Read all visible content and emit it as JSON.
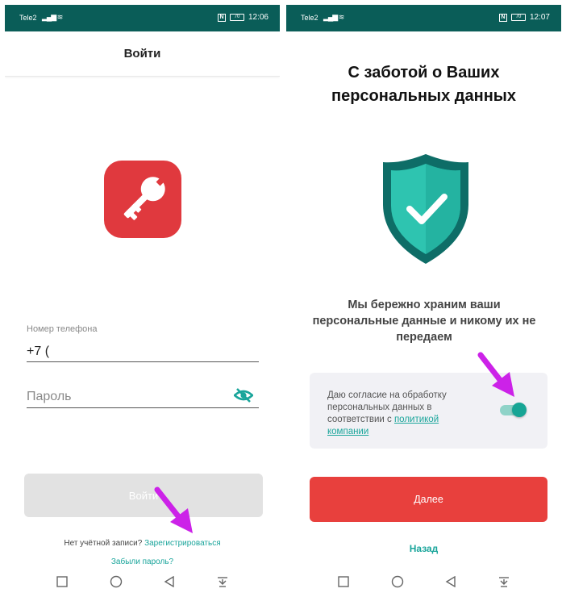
{
  "login": {
    "status": {
      "carrier": "Tele2",
      "time": "12:06",
      "battery": "70"
    },
    "title": "Войти",
    "phone_label": "Номер телефона",
    "phone_value": "+7 (",
    "password_placeholder": "Пароль",
    "login_button": "Войти",
    "no_account_text": "Нет учётной записи?",
    "register_link": "Зарегистрироваться",
    "forgot_link": "Забыли пароль?",
    "logo_icon": "key-icon",
    "eye_icon": "eye-off-icon"
  },
  "consent": {
    "status": {
      "carrier": "Tele2",
      "time": "12:07",
      "battery": "70"
    },
    "title": "С заботой о Ваших персональных данных",
    "subtitle": "Мы бережно храним ваши персональные данные и никому их не передаем",
    "consent_text": "Даю согласие на обработку персональных данных в соответствии с",
    "policy_link": "политикой компании",
    "consent_enabled": true,
    "next_button": "Далее",
    "back_link": "Назад",
    "shield_icon": "shield-check-icon"
  },
  "colors": {
    "status_bar": "#0a5d58",
    "accent_teal": "#1aa59b",
    "brand_red": "#e0393e",
    "arrow_magenta": "#cc22e8"
  }
}
